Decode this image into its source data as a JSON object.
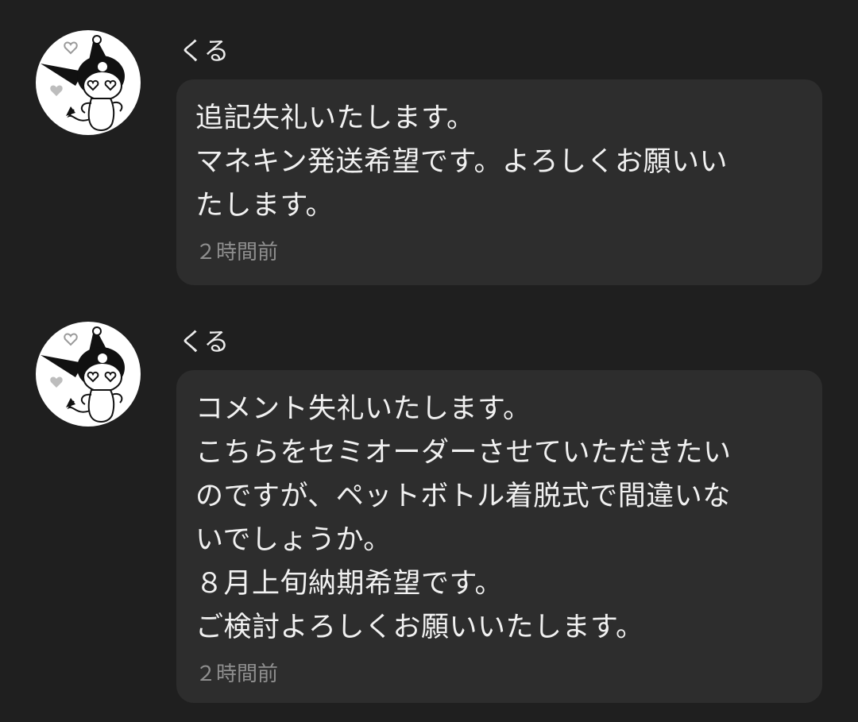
{
  "comments": [
    {
      "username": "くる",
      "avatar_icon": "kuromi-avatar-icon",
      "lines": [
        "追記失礼いたします。",
        "マネキン発送希望です。よろしくお願いい",
        "たします。"
      ],
      "time": "２時間前"
    },
    {
      "username": "くる",
      "avatar_icon": "kuromi-avatar-icon",
      "lines": [
        "コメント失礼いたします。",
        "こちらをセミオーダーさせていただきたい",
        "のですが、ペットボトル着脱式で間違いな",
        "いでしょうか。",
        "８月上旬納期希望です。",
        "ご検討よろしくお願いいたします。"
      ],
      "time": "２時間前"
    }
  ],
  "colors": {
    "background": "#1f1f1f",
    "bubble": "#2d2d2d",
    "text": "#f1f1f1",
    "muted": "#8f8f8f"
  }
}
